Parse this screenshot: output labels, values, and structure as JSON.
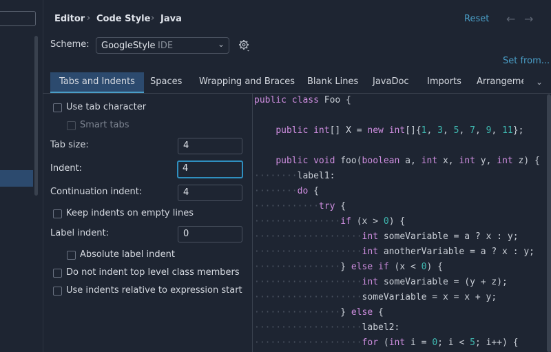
{
  "breadcrumb": {
    "a": "Editor",
    "b": "Code Style",
    "c": "Java",
    "sep": "›"
  },
  "header": {
    "reset": "Reset",
    "back": "←",
    "forward": "→"
  },
  "scheme": {
    "label": "Scheme:",
    "name": "GoogleStyle",
    "tag": "IDE",
    "chevron": "⌄"
  },
  "set_from": "Set from...",
  "tabs": [
    "Tabs and Indents",
    "Spaces",
    "Wrapping and Braces",
    "Blank Lines",
    "JavaDoc",
    "Imports",
    "Arrangeme"
  ],
  "tabs_more": "⌄",
  "settings": {
    "use_tab": "Use tab character",
    "smart_tabs": "Smart tabs",
    "tab_size_label": "Tab size:",
    "tab_size": "4",
    "indent_label": "Indent:",
    "indent": "4",
    "cont_indent_label": "Continuation indent:",
    "cont_indent": "4",
    "keep_indents": "Keep indents on empty lines",
    "label_indent_label": "Label indent:",
    "label_indent": "0",
    "absolute_label": "Absolute label indent",
    "no_indent_top": "Do not indent top level class members",
    "relative_indents": "Use indents relative to expression start"
  },
  "code": {
    "l1a": "public class",
    "l1b": " Foo {",
    "l2a": "public",
    "l2b": " int",
    "l2c": "[] X = ",
    "l2d": "new",
    "l2e": " int",
    "l2f": "[]{",
    "l2n1": "1",
    "l2n2": "3",
    "l2n3": "5",
    "l2n4": "7",
    "l2n5": "9",
    "l2n6": "11",
    "l2g": "};",
    "comma": ", ",
    "l3a": "public void",
    "l3b": " foo(",
    "l3c": "boolean",
    "l3d": " a, ",
    "l3e": "int",
    "l3f": " x, ",
    "l3g": "int",
    "l3h": " y, ",
    "l3i": "int",
    "l3j": " z) {",
    "l4": "label1:",
    "l5a": "do",
    "l5b": " {",
    "l6a": "try",
    "l6b": " {",
    "l7a": "if",
    "l7b": " (x > ",
    "l7c": "0",
    "l7d": ") {",
    "l8a": "int",
    "l8b": " someVariable = a ? x : y;",
    "l9a": "int",
    "l9b": " anotherVariable = a ? x : y;",
    "l10a": "} ",
    "l10b": "else if",
    "l10c": " (x < ",
    "l10d": "0",
    "l10e": ") {",
    "l11a": "int",
    "l11b": " someVariable = (y + z);",
    "l12": "someVariable = x = x + y;",
    "l13a": "} ",
    "l13b": "else",
    "l13c": " {",
    "l14": "label2:",
    "l15a": "for",
    "l15b": " (",
    "l15c": "int",
    "l15d": " i = ",
    "l15e": "0",
    "l15f": "; i < ",
    "l15g": "5",
    "l15h": "; i++) {"
  },
  "colors": {
    "accent": "#4a9ec7",
    "selection": "#2c4a6e",
    "keyword": "#cf8ee0",
    "number": "#3fb8b0",
    "background": "#1e2532"
  }
}
